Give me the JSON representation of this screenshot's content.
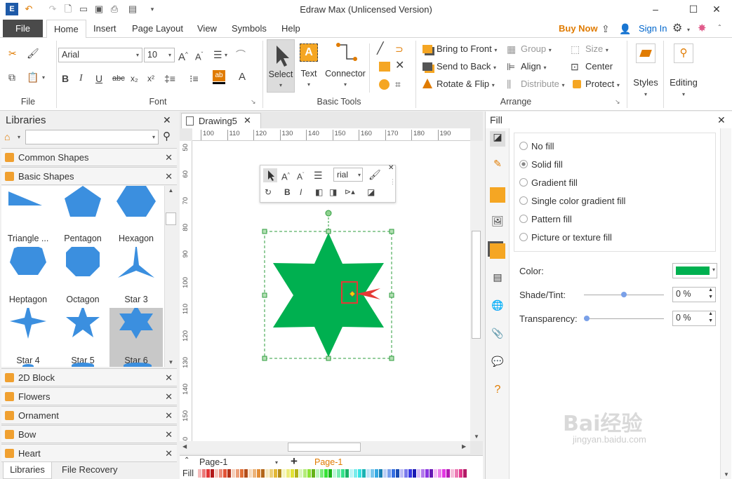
{
  "window": {
    "title": "Edraw Max (Unlicensed Version)"
  },
  "tabs": {
    "file": "File",
    "home": "Home",
    "insert": "Insert",
    "page_layout": "Page Layout",
    "view": "View",
    "symbols": "Symbols",
    "help": "Help"
  },
  "header": {
    "buy_now": "Buy Now",
    "sign_in": "Sign In"
  },
  "ribbon": {
    "file_group": "File",
    "font_group": "Font",
    "font_name": "Arial",
    "font_size": "10",
    "basic_tools_group": "Basic Tools",
    "select": "Select",
    "text": "Text",
    "connector": "Connector",
    "arrange_group": "Arrange",
    "bring_to_front": "Bring to Front",
    "send_to_back": "Send to Back",
    "rotate_flip": "Rotate & Flip",
    "group": "Group",
    "align": "Align",
    "distribute": "Distribute",
    "size": "Size",
    "center": "Center",
    "protect": "Protect",
    "styles": "Styles",
    "editing": "Editing"
  },
  "libraries": {
    "title": "Libraries",
    "categories": [
      "Common Shapes",
      "Basic Shapes"
    ],
    "shapes": [
      "Triangle ...",
      "Pentagon",
      "Hexagon",
      "Heptagon",
      "Octagon",
      "Star 3",
      "Star 4",
      "Star 5",
      "Star 6"
    ],
    "more": [
      "2D Block",
      "Flowers",
      "Ornament",
      "Bow",
      "Heart"
    ],
    "bottom_tabs": [
      "Libraries",
      "File Recovery"
    ]
  },
  "document": {
    "tab": "Drawing5",
    "hruler": [
      "100",
      "110",
      "120",
      "130",
      "140",
      "150",
      "160",
      "170",
      "180",
      "190"
    ],
    "vruler": [
      "50",
      "60",
      "70",
      "80",
      "90",
      "100",
      "110",
      "120",
      "130",
      "140",
      "150",
      "160"
    ],
    "mini_font": "rial",
    "page_select": "Page-1",
    "page_tab": "Page-1",
    "fill_label": "Fill"
  },
  "fill": {
    "title": "Fill",
    "options": [
      "No fill",
      "Solid fill",
      "Gradient fill",
      "Single color gradient fill",
      "Pattern fill",
      "Picture or texture fill"
    ],
    "selected": "Solid fill",
    "color_label": "Color:",
    "color": "#00b050",
    "shade_label": "Shade/Tint:",
    "shade_value": "0 %",
    "shade_level": 0.5,
    "transparency_label": "Transparency:",
    "transparency_value": "0 %",
    "transparency_level": 0
  },
  "colors": {
    "accent": "#0066cc",
    "buy": "#e07b00",
    "shape_blue": "#3b8fdf",
    "star": "#00b050"
  },
  "watermark": {
    "text": "Bai经验",
    "sub": "jingyan.baidu.com"
  }
}
